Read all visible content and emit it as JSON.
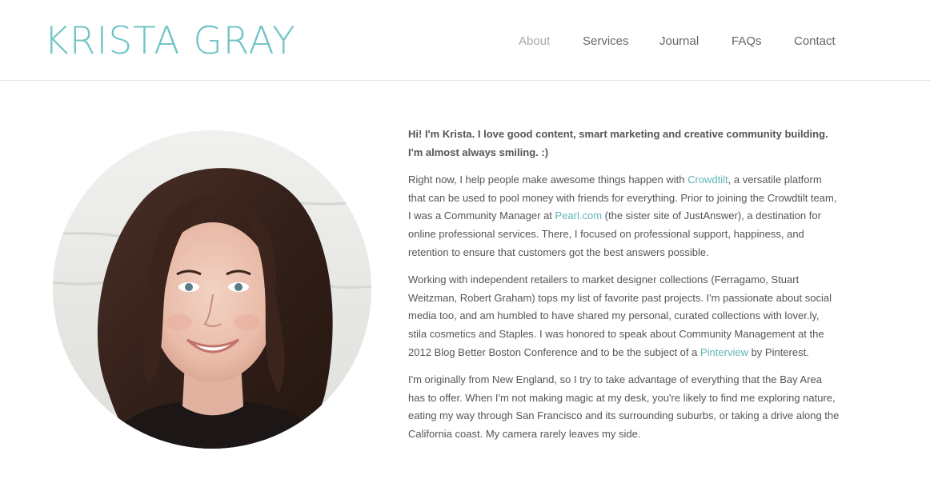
{
  "site": {
    "logo": "KRISTA GRAY"
  },
  "nav": {
    "items": [
      {
        "label": "About",
        "active": true
      },
      {
        "label": "Services",
        "active": false
      },
      {
        "label": "Journal",
        "active": false
      },
      {
        "label": "FAQs",
        "active": false
      },
      {
        "label": "Contact",
        "active": false
      }
    ]
  },
  "colors": {
    "accent": "#6fc3c6",
    "link": "#5fb5b8",
    "nav_active": "#a8a8a8",
    "text": "#555555"
  },
  "bio": {
    "intro": "Hi! I'm Krista. I love good content, smart marketing and creative community building. I'm almost always smiling. :)",
    "p1": {
      "t1": "Right now, I help people make awesome things happen with ",
      "link1": "Crowdtilt",
      "t2": ", a versatile platform that can be used to pool money with friends for everything. Prior to joining the Crowdtilt team, I was a Community Manager at ",
      "link2": "Pearl.com",
      "t3": " (the sister site of JustAnswer), a destination for online professional services. There, I focused on professional support, happiness, and retention to ensure that customers got the best answers possible."
    },
    "p2": {
      "t1": "Working with independent retailers to market designer collections (Ferragamo, Stuart Weitzman, Robert Graham) tops my list of favorite past projects. I'm passionate about social media too, and am humbled to have shared my personal, curated collections with lover.ly, stila cosmetics and Staples. I was honored to speak about Community Management at the 2012 Blog Better Boston Conference and to be the subject of a ",
      "link1": "Pinterview",
      "t2": " by Pinterest."
    },
    "p3": "I'm originally from New England, so I try to take advantage of everything that the Bay Area has to offer. When I'm not making magic at my desk, you're likely to find me exploring nature, eating my way through San Francisco and its surrounding suburbs, or taking a drive along the California coast.  My camera rarely leaves my side."
  }
}
